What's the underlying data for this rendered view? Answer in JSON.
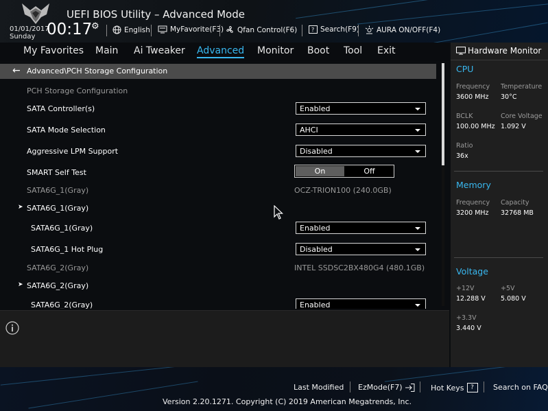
{
  "header": {
    "title": "UEFI BIOS Utility – Advanced Mode",
    "date": "01/01/2017",
    "day": "Sunday",
    "time": "00:17",
    "language_label": "English",
    "myfavorite_label": "MyFavorite(F3)",
    "qfan_label": "Qfan Control(F6)",
    "search_label": "Search(F9)",
    "aura_label": "AURA ON/OFF(F4)"
  },
  "menu": {
    "tabs": [
      {
        "label": "My Favorites"
      },
      {
        "label": "Main"
      },
      {
        "label": "Ai Tweaker"
      },
      {
        "label": "Advanced"
      },
      {
        "label": "Monitor"
      },
      {
        "label": "Boot"
      },
      {
        "label": "Tool"
      },
      {
        "label": "Exit"
      }
    ],
    "active": "Advanced"
  },
  "breadcrumb": {
    "path": "Advanced\\PCH Storage Configuration"
  },
  "settings": {
    "section_title": "PCH Storage Configuration",
    "sata_controller": {
      "label": "SATA Controller(s)",
      "value": "Enabled"
    },
    "sata_mode": {
      "label": "SATA Mode Selection",
      "value": "AHCI"
    },
    "aggressive_lpm": {
      "label": "Aggressive LPM Support",
      "value": "Disabled"
    },
    "smart_self_test": {
      "label": "SMART Self Test",
      "on_label": "On",
      "off_label": "Off",
      "selected": "On"
    },
    "port1_info": {
      "label": "SATA6G_1(Gray)",
      "value": "OCZ-TRION100 (240.0GB)"
    },
    "port1_group": {
      "label": "SATA6G_1(Gray)"
    },
    "port1_enable": {
      "label": "SATA6G_1(Gray)",
      "value": "Enabled"
    },
    "port1_hotplug": {
      "label": "SATA6G_1 Hot Plug",
      "value": "Disabled"
    },
    "port2_info": {
      "label": "SATA6G_2(Gray)",
      "value": "INTEL SSDSC2BX480G4 (480.1GB)"
    },
    "port2_group": {
      "label": "SATA6G_2(Gray)"
    },
    "port2_enable": {
      "label": "SATA6G_2(Gray)",
      "value": "Enabled"
    }
  },
  "hardware_monitor": {
    "title": "Hardware Monitor",
    "cpu": {
      "title": "CPU",
      "frequency_label": "Frequency",
      "frequency": "3600 MHz",
      "temperature_label": "Temperature",
      "temperature": "30°C",
      "bclk_label": "BCLK",
      "bclk": "100.00 MHz",
      "core_voltage_label": "Core Voltage",
      "core_voltage": "1.092 V",
      "ratio_label": "Ratio",
      "ratio": "36x"
    },
    "memory": {
      "title": "Memory",
      "frequency_label": "Frequency",
      "frequency": "3200 MHz",
      "capacity_label": "Capacity",
      "capacity": "32768 MB"
    },
    "voltage": {
      "title": "Voltage",
      "v12_label": "+12V",
      "v12": "12.288 V",
      "v5_label": "+5V",
      "v5": "5.080 V",
      "v33_label": "+3.3V",
      "v33": "3.440 V"
    }
  },
  "footer": {
    "last_modified": "Last Modified",
    "ezmode": "EzMode(F7)",
    "hotkeys": "Hot Keys",
    "hotkeys_key": "?",
    "search_faq": "Search on FAQ",
    "copyright": "Version 2.20.1271. Copyright (C) 2019 American Megatrends, Inc."
  },
  "scrollbar": {
    "position_fraction": 0.0,
    "visible_fraction": 0.42
  },
  "colors": {
    "accent": "#39b8f0",
    "row_gray": "#9a9a9a",
    "panel": "#1f1f1f"
  }
}
